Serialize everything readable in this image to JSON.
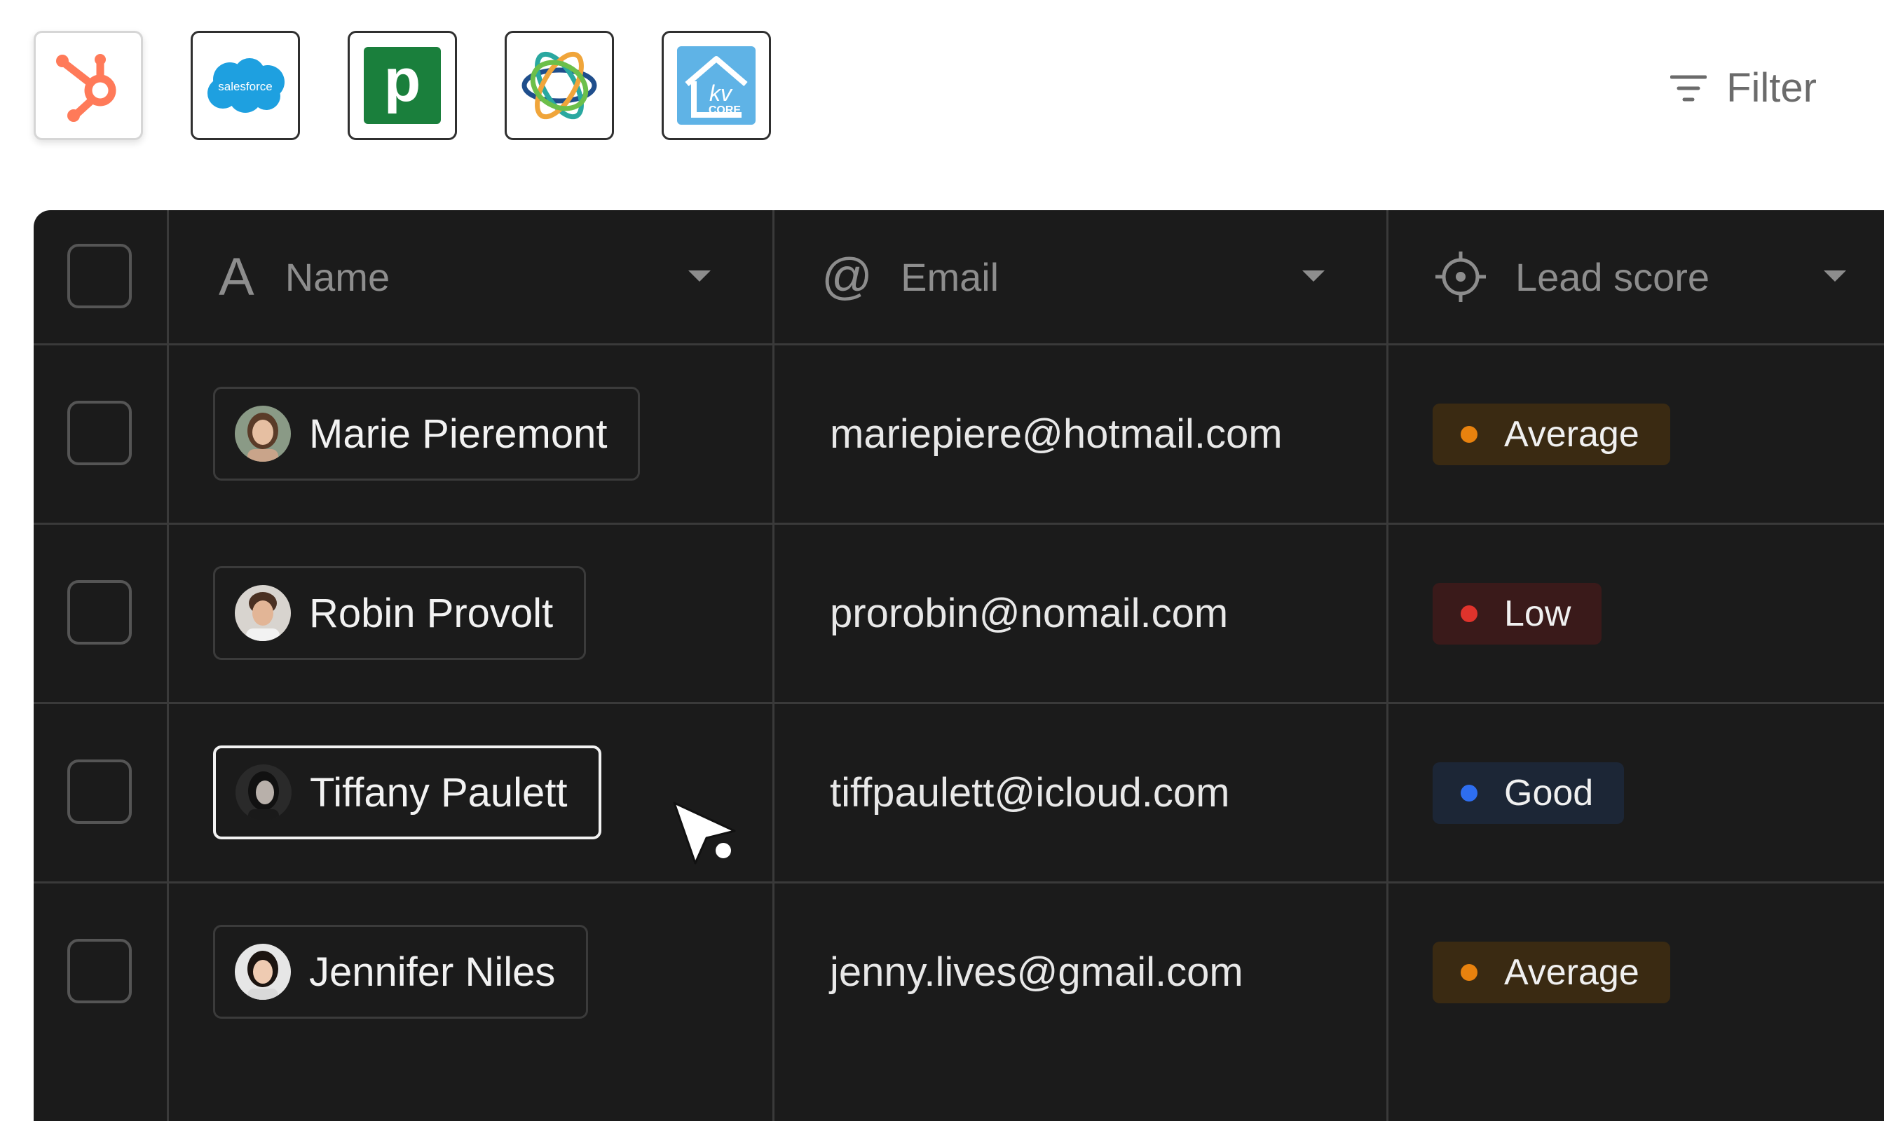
{
  "integrations": [
    {
      "name": "hubspot-icon"
    },
    {
      "name": "salesforce-icon",
      "text": "salesforce"
    },
    {
      "name": "pipedrive-icon",
      "text": "p"
    },
    {
      "name": "integration-rings-icon"
    },
    {
      "name": "kvcore-icon",
      "text_top": "kv",
      "text_bottom": "CORE"
    }
  ],
  "filter": {
    "label": "Filter",
    "icon": "filter-icon"
  },
  "table": {
    "columns": [
      {
        "label": "Name",
        "icon": "text-type-icon"
      },
      {
        "label": "Email",
        "icon": "at-sign-icon"
      },
      {
        "label": "Lead score",
        "icon": "crosshair-icon"
      }
    ],
    "rows": [
      {
        "name": "Marie Pieremont",
        "email": "mariepiere@hotmail.com",
        "score": "Average"
      },
      {
        "name": "Robin Provolt",
        "email": "prorobin@nomail.com",
        "score": "Low"
      },
      {
        "name": "Tiffany Paulett",
        "email": "tiffpaulett@icloud.com",
        "score": "Good"
      },
      {
        "name": "Jennifer Niles",
        "email": "jenny.lives@gmail.com",
        "score": "Average"
      }
    ]
  },
  "colors": {
    "average": "#e8820e",
    "low": "#e0332c",
    "good": "#2e6ef0",
    "hubspot": "#ff7a59",
    "salesforce": "#1ea0e0",
    "pipedrive": "#1a7f3c",
    "kvcore": "#5fb3e6"
  }
}
